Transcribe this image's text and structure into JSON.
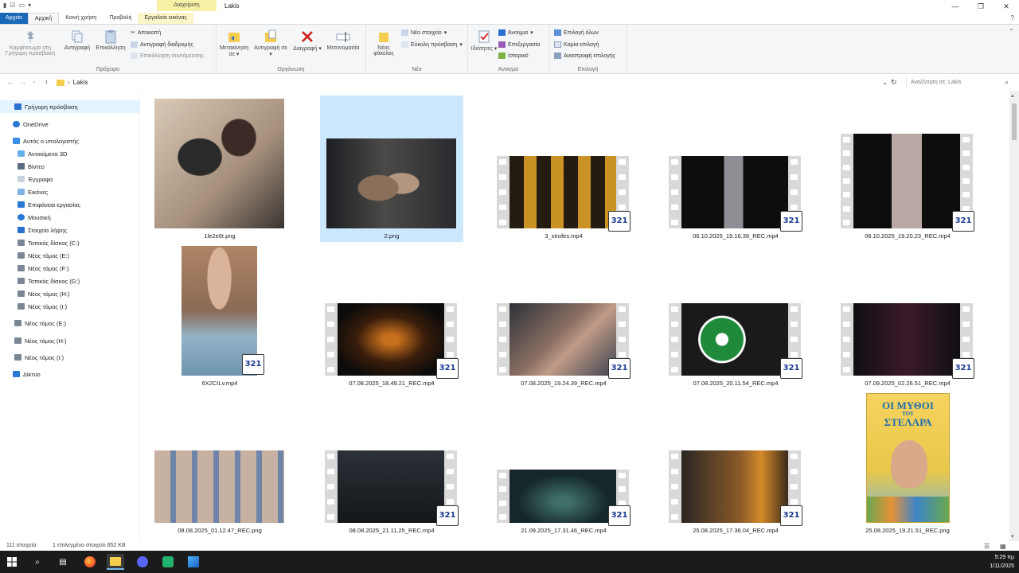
{
  "window": {
    "title": "Lakis",
    "context_tab_group": "Διαχείριση"
  },
  "ribbon_tabs": [
    "Αρχείο",
    "Αρχική",
    "Κοινή χρήση",
    "Προβολή",
    "Εργαλεία εικόνας"
  ],
  "ribbon": {
    "clipboard": {
      "group_label": "Πρόχειρο",
      "pin": "Καρφίτσωμα στη Γρήγορη πρόσβαση",
      "copy": "Αντιγραφή",
      "paste": "Επικόλληση",
      "cut": "Αποκοπή",
      "copy_path": "Αντιγραφή διαδρομής",
      "paste_shortcut": "Επικόλληση συντόμευσης"
    },
    "organize": {
      "group_label": "Οργάνωση",
      "move_to": "Μετακίνηση σε",
      "copy_to": "Αντιγραφή σε",
      "delete": "Διαγραφή",
      "rename": "Μετονομασία"
    },
    "new": {
      "group_label": "Νέο",
      "new_folder": "Νέος φάκελος",
      "new_item": "Νέο στοιχείο",
      "easy_access": "Εύκολη πρόσβαση"
    },
    "open": {
      "group_label": "Άνοιγμα",
      "properties": "Ιδιότητες",
      "open": "Άνοιγμα",
      "edit": "Επεξεργασία",
      "history": "Ιστορικό"
    },
    "select": {
      "group_label": "Επιλογή",
      "select_all": "Επιλογή όλων",
      "select_none": "Καμία επιλογή",
      "invert": "Αναστροφή επιλογής"
    }
  },
  "address": {
    "path": "Lakis",
    "search_placeholder": "Αναζήτηση σε: Lakis"
  },
  "nav": {
    "quick_access": "Γρήγορη πρόσβαση",
    "onedrive": "OneDrive",
    "this_pc": "Αυτός ο υπολογιστής",
    "objects3d": "Αντικείμενα 3D",
    "videos": "Βίντεο",
    "documents": "Έγγραφα",
    "pictures": "Εικόνες",
    "desktop": "Επιφάνεια εργασίας",
    "music": "Μουσική",
    "downloads": "Στοιχεία λήψης",
    "disk_c": "Τοπικός δίσκος (C:)",
    "vol_e": "Νέος τόμος (E:)",
    "vol_f": "Νέος τόμος (F:)",
    "disk_g": "Τοπικός δίσκος (G:)",
    "vol_h": "Νέος τόμος (H:)",
    "vol_i": "Νέος τόμος (I:)",
    "vol_e2": "Νέος τόμος (E:)",
    "vol_h2": "Νέος τόμος (H:)",
    "vol_i2": "Νέος τόμος (I:)",
    "network": "Δίκτυο"
  },
  "files": [
    {
      "name": "1le2e6t.png",
      "kind": "image",
      "selected": false
    },
    {
      "name": "2.png",
      "kind": "image",
      "selected": true
    },
    {
      "name": "3_strofes.mp4",
      "kind": "video",
      "selected": false
    },
    {
      "name": "06.10.2025_19.16.39_REC.mp4",
      "kind": "video",
      "selected": false
    },
    {
      "name": "06.10.2025_19.20.23_REC.mp4",
      "kind": "video",
      "selected": false
    },
    {
      "name": "6X2CILv.mp4",
      "kind": "video",
      "selected": false
    },
    {
      "name": "07.08.2025_18.49.21_REC.mp4",
      "kind": "video",
      "selected": false
    },
    {
      "name": "07.08.2025_19.24.39_REC.mp4",
      "kind": "video",
      "selected": false
    },
    {
      "name": "07.08.2025_20.11.54_REC.mp4",
      "kind": "video",
      "selected": false
    },
    {
      "name": "07.09.2025_02.26.51_REC.mp4",
      "kind": "video",
      "selected": false
    },
    {
      "name": "08.08.2025_01.12.47_REC.png",
      "kind": "image",
      "selected": false
    },
    {
      "name": "08.08.2025_21.11.25_REC.mp4",
      "kind": "video",
      "selected": false
    },
    {
      "name": "21.09.2025_17.31.46_REC.mp4",
      "kind": "video",
      "selected": false
    },
    {
      "name": "25.08.2025_17.36.04_REC.mp4",
      "kind": "video",
      "selected": false
    },
    {
      "name": "25.08.2025_19.21.51_REC.png",
      "kind": "image",
      "selected": false
    }
  ],
  "video_badge": "321",
  "book_cover": {
    "title": "ΟΙ ΜΥΘΟΙ",
    "sub": "ΤΟΥ",
    "name": "ΣΤΕΛΑΡΑ"
  },
  "status": {
    "count": "111 στοιχεία",
    "selection": "1 επιλεγμένο στοιχείο 852 KB"
  },
  "clock": {
    "time": "5:29 πμ",
    "date": "1/11/2025"
  },
  "colors": {
    "accent": "#1a69b8",
    "selected_bg": "#cce8ff",
    "context_tab": "#f7f1a6"
  }
}
